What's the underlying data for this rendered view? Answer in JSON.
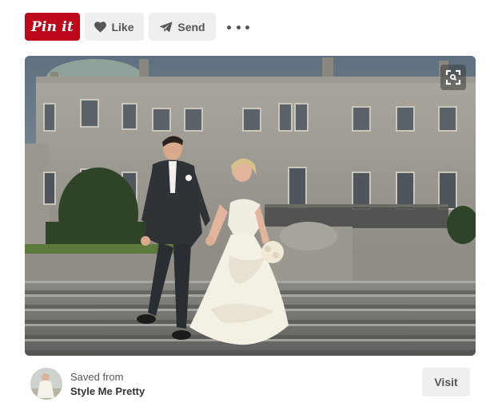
{
  "toolbar": {
    "pin_label": "Pin it",
    "like_label": "Like",
    "send_label": "Send",
    "icons": {
      "like": "heart-icon",
      "send": "paper-plane-icon",
      "more": "more-options-icon"
    }
  },
  "pin": {
    "image": "wedding-couple-on-stone-steps-photo",
    "expand_icon": "expand-icon"
  },
  "source": {
    "saved_from": "Saved from",
    "name": "Style Me Pretty",
    "avatar": "source-avatar",
    "visit_label": "Visit"
  },
  "colors": {
    "pinterest_red": "#bd081c",
    "button_gray": "#efefef",
    "text_gray": "#555555"
  }
}
